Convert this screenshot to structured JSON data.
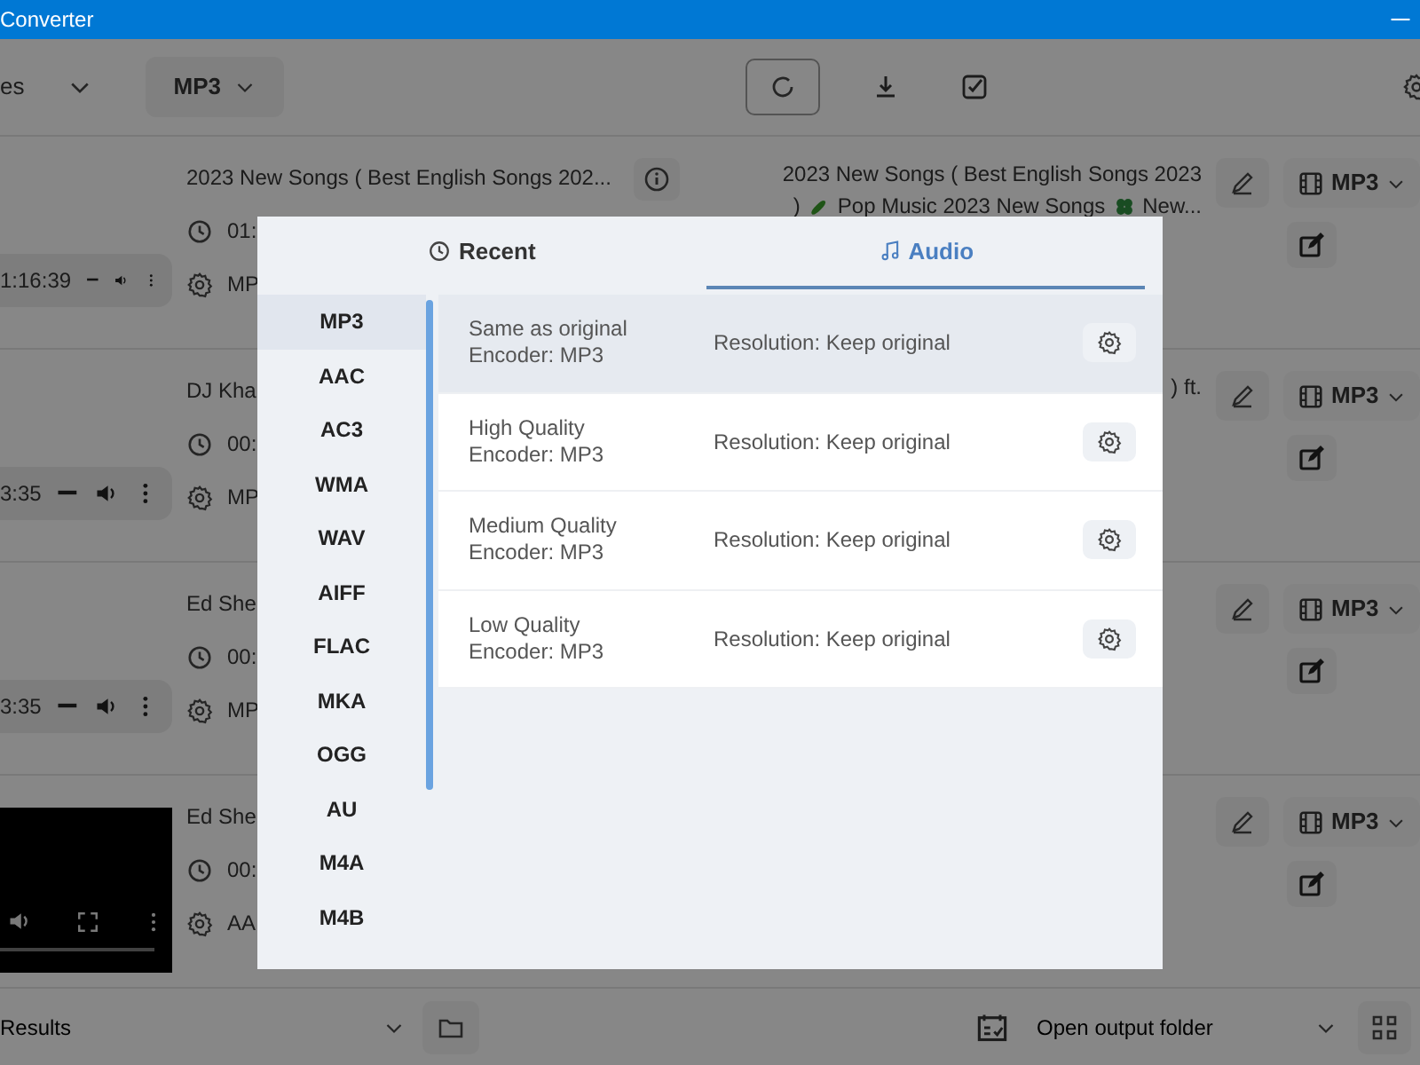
{
  "window": {
    "title": "Converter"
  },
  "toolbar": {
    "source_select": "es",
    "format_select": "MP3"
  },
  "files": [
    {
      "kind": "player",
      "time": "1:16:39",
      "title": "2023 New Songs ( Best English Songs 202...",
      "duration": "01:",
      "format": "MP",
      "output_title": [
        {
          "kind": "text",
          "text": "2023 New Songs ( Best English Songs 2023"
        },
        {
          "kind": "text",
          "text": ")"
        },
        {
          "kind": "cucumber"
        },
        {
          "kind": "text",
          "text": "Pop Music 2023 New Songs"
        },
        {
          "kind": "clover"
        },
        {
          "kind": "text",
          "text": "New..."
        }
      ],
      "output_format": "MP3"
    },
    {
      "kind": "player",
      "time": "3:35",
      "title": "DJ Kha",
      "duration": "00:",
      "format": "MP",
      "output_title": [
        {
          "kind": "text",
          "text": ") ft."
        }
      ],
      "output_format": "MP3"
    },
    {
      "kind": "player",
      "time": "3:35",
      "title": "Ed She",
      "duration": "00:",
      "format": "MP",
      "output_format": "MP3"
    },
    {
      "kind": "video",
      "title": "Ed She",
      "duration": "00:",
      "format": "AA",
      "output_format": "MP3"
    }
  ],
  "dialog": {
    "tabs": [
      {
        "label": "Recent",
        "selected": false
      },
      {
        "label": "Audio",
        "selected": true
      }
    ],
    "formats": [
      {
        "label": "MP3",
        "selected": true
      },
      {
        "label": "AAC",
        "selected": false
      },
      {
        "label": "AC3",
        "selected": false
      },
      {
        "label": "WMA",
        "selected": false
      },
      {
        "label": "WAV",
        "selected": false
      },
      {
        "label": "AIFF",
        "selected": false
      },
      {
        "label": "FLAC",
        "selected": false
      },
      {
        "label": "MKA",
        "selected": false
      },
      {
        "label": "OGG",
        "selected": false
      },
      {
        "label": "AU",
        "selected": false
      },
      {
        "label": "M4A",
        "selected": false
      },
      {
        "label": "M4B",
        "selected": false
      }
    ],
    "presets": [
      {
        "name": "Same as original",
        "encoder": "Encoder: MP3",
        "resolution": "Resolution: Keep original",
        "selected": true
      },
      {
        "name": "High Quality",
        "encoder": "Encoder: MP3",
        "resolution": "Resolution: Keep original",
        "selected": false
      },
      {
        "name": "Medium Quality",
        "encoder": "Encoder: MP3",
        "resolution": "Resolution: Keep original",
        "selected": false
      },
      {
        "name": "Low Quality",
        "encoder": "Encoder: MP3",
        "resolution": "Resolution: Keep original",
        "selected": false
      }
    ]
  },
  "footer": {
    "output_select": "Results",
    "action_select": "Open output folder"
  }
}
